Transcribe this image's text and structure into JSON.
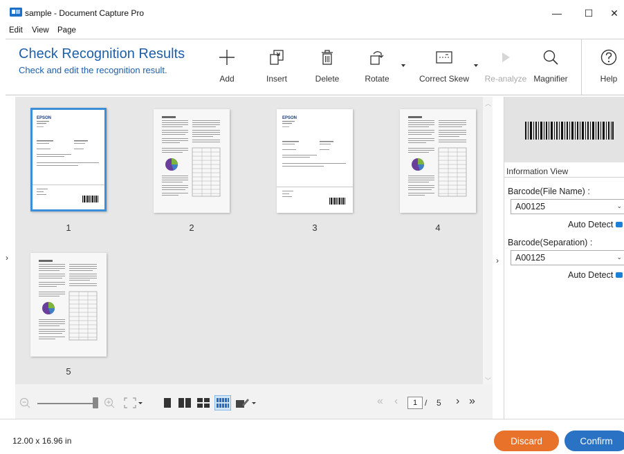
{
  "window": {
    "title": "sample - Document Capture Pro",
    "minimize_glyph": "—",
    "maximize_glyph": "☐",
    "close_glyph": "✕"
  },
  "menu": [
    "Edit",
    "View",
    "Page"
  ],
  "ribbon": {
    "title": "Check Recognition Results",
    "subtitle": "Check and edit the recognition result.",
    "tools": {
      "add": "Add",
      "insert": "Insert",
      "delete": "Delete",
      "rotate": "Rotate",
      "correct_skew": "Correct Skew",
      "reanalyze": "Re-analyze",
      "magnifier": "Magnifier",
      "help": "Help"
    },
    "accent_color": "#1f5fa8"
  },
  "pages": [
    {
      "num": "1",
      "type": "form",
      "selected": true
    },
    {
      "num": "2",
      "type": "report",
      "selected": false
    },
    {
      "num": "3",
      "type": "form",
      "selected": false
    },
    {
      "num": "4",
      "type": "report",
      "selected": false
    },
    {
      "num": "5",
      "type": "report",
      "selected": false
    }
  ],
  "pager": {
    "current": "1",
    "separator": "/",
    "total": "5"
  },
  "right_panel": {
    "info_view_title": "Information View",
    "barcode_file_label": "Barcode(File Name) :",
    "barcode_file_value": "A00125",
    "barcode_sep_label": "Barcode(Separation) :",
    "barcode_sep_value": "A00125",
    "auto_detect": "Auto Detect",
    "collapse_glyph": "›"
  },
  "left_collapse_glyph": "›",
  "status": {
    "page_size": "12.00 x 16.96 in"
  },
  "buttons": {
    "discard": "Discard",
    "confirm": "Confirm",
    "discard_color": "#e8722a",
    "confirm_color": "#2a73c4"
  }
}
